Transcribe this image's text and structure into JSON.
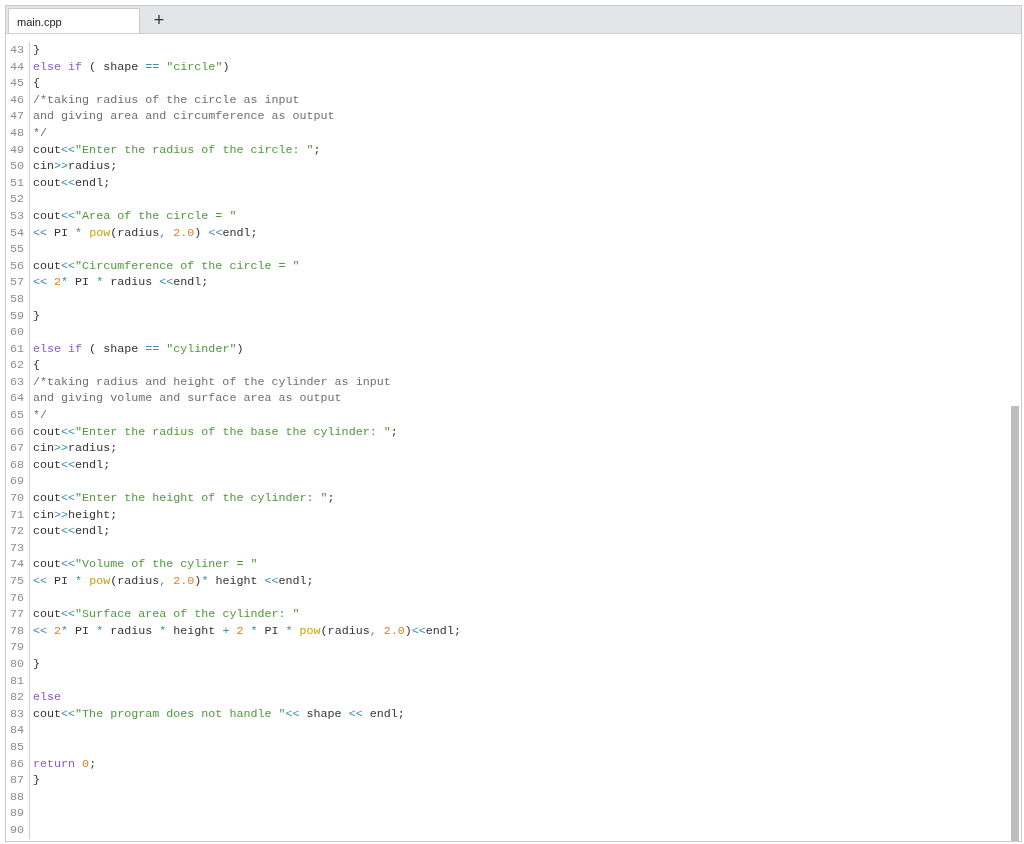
{
  "tabs": [
    {
      "label": "main.cpp",
      "selected": true
    }
  ],
  "new_tab": {
    "label": "+"
  },
  "lines": [
    {
      "number": "43",
      "tokens": [
        {
          "kind": "plain",
          "text": "}"
        }
      ]
    },
    {
      "number": "44",
      "tokens": [
        {
          "kind": "keyword",
          "text": "else if"
        },
        {
          "kind": "plain",
          "text": " ( shape "
        },
        {
          "kind": "operator",
          "text": "== "
        },
        {
          "kind": "string",
          "text": "\"circle\""
        },
        {
          "kind": "plain",
          "text": ")"
        }
      ]
    },
    {
      "number": "45",
      "tokens": [
        {
          "kind": "plain",
          "text": "{"
        }
      ]
    },
    {
      "number": "46",
      "tokens": [
        {
          "kind": "comment",
          "text": "/*taking radius of the circle as input"
        }
      ]
    },
    {
      "number": "47",
      "tokens": [
        {
          "kind": "comment",
          "text": "and giving area and circumference as output"
        }
      ]
    },
    {
      "number": "48",
      "tokens": [
        {
          "kind": "comment",
          "text": "*/"
        }
      ]
    },
    {
      "number": "49",
      "tokens": [
        {
          "kind": "plain",
          "text": "cout"
        },
        {
          "kind": "operator",
          "text": "<<"
        },
        {
          "kind": "string",
          "text": "\"Enter the radius of the circle: \""
        },
        {
          "kind": "plain",
          "text": ";"
        }
      ]
    },
    {
      "number": "50",
      "tokens": [
        {
          "kind": "plain",
          "text": "cin"
        },
        {
          "kind": "operator",
          "text": ">>"
        },
        {
          "kind": "plain",
          "text": "radius;"
        }
      ]
    },
    {
      "number": "51",
      "tokens": [
        {
          "kind": "plain",
          "text": "cout"
        },
        {
          "kind": "operator",
          "text": "<<"
        },
        {
          "kind": "plain",
          "text": "endl;"
        }
      ]
    },
    {
      "number": "52"
    },
    {
      "number": "53",
      "tokens": [
        {
          "kind": "plain",
          "text": "cout"
        },
        {
          "kind": "operator",
          "text": "<<"
        },
        {
          "kind": "string",
          "text": "\"Area of the circle = \""
        }
      ]
    },
    {
      "number": "54",
      "tokens": [
        {
          "kind": "operator",
          "text": "<<"
        },
        {
          "kind": "plain",
          "text": " PI "
        },
        {
          "kind": "operator",
          "text": "* "
        },
        {
          "kind": "function",
          "text": "pow"
        },
        {
          "kind": "plain",
          "text": "(radius"
        },
        {
          "kind": "operator",
          "text": ", "
        },
        {
          "kind": "number",
          "text": "2.0"
        },
        {
          "kind": "plain",
          "text": ") "
        },
        {
          "kind": "operator",
          "text": "<<"
        },
        {
          "kind": "plain",
          "text": "endl;"
        }
      ]
    },
    {
      "number": "55"
    },
    {
      "number": "56",
      "tokens": [
        {
          "kind": "plain",
          "text": "cout"
        },
        {
          "kind": "operator",
          "text": "<<"
        },
        {
          "kind": "string",
          "text": "\"Circumference of the circle = \""
        }
      ]
    },
    {
      "number": "57",
      "tokens": [
        {
          "kind": "operator",
          "text": "<< "
        },
        {
          "kind": "number",
          "text": "2"
        },
        {
          "kind": "operator",
          "text": "*"
        },
        {
          "kind": "plain",
          "text": " PI "
        },
        {
          "kind": "operator",
          "text": "*"
        },
        {
          "kind": "plain",
          "text": " radius "
        },
        {
          "kind": "operator",
          "text": "<<"
        },
        {
          "kind": "plain",
          "text": "endl;"
        }
      ]
    },
    {
      "number": "58"
    },
    {
      "number": "59",
      "tokens": [
        {
          "kind": "plain",
          "text": "}"
        }
      ]
    },
    {
      "number": "60"
    },
    {
      "number": "61",
      "tokens": [
        {
          "kind": "keyword",
          "text": "else if"
        },
        {
          "kind": "plain",
          "text": " ( shape "
        },
        {
          "kind": "operator",
          "text": "== "
        },
        {
          "kind": "string",
          "text": "\"cylinder\""
        },
        {
          "kind": "plain",
          "text": ")"
        }
      ]
    },
    {
      "number": "62",
      "tokens": [
        {
          "kind": "plain",
          "text": "{"
        }
      ]
    },
    {
      "number": "63",
      "tokens": [
        {
          "kind": "comment",
          "text": "/*taking radius and height of the cylinder as input"
        }
      ]
    },
    {
      "number": "64",
      "tokens": [
        {
          "kind": "comment",
          "text": "and giving volume and surface area as output"
        }
      ]
    },
    {
      "number": "65",
      "tokens": [
        {
          "kind": "comment",
          "text": "*/"
        }
      ]
    },
    {
      "number": "66",
      "tokens": [
        {
          "kind": "plain",
          "text": "cout"
        },
        {
          "kind": "operator",
          "text": "<<"
        },
        {
          "kind": "string",
          "text": "\"Enter the radius of the base the cylinder: \""
        },
        {
          "kind": "plain",
          "text": ";"
        }
      ]
    },
    {
      "number": "67",
      "tokens": [
        {
          "kind": "plain",
          "text": "cin"
        },
        {
          "kind": "operator",
          "text": ">>"
        },
        {
          "kind": "plain",
          "text": "radius;"
        }
      ]
    },
    {
      "number": "68",
      "tokens": [
        {
          "kind": "plain",
          "text": "cout"
        },
        {
          "kind": "operator",
          "text": "<<"
        },
        {
          "kind": "plain",
          "text": "endl;"
        }
      ]
    },
    {
      "number": "69"
    },
    {
      "number": "70",
      "tokens": [
        {
          "kind": "plain",
          "text": "cout"
        },
        {
          "kind": "operator",
          "text": "<<"
        },
        {
          "kind": "string",
          "text": "\"Enter the height of the cylinder: \""
        },
        {
          "kind": "plain",
          "text": ";"
        }
      ]
    },
    {
      "number": "71",
      "tokens": [
        {
          "kind": "plain",
          "text": "cin"
        },
        {
          "kind": "operator",
          "text": ">>"
        },
        {
          "kind": "plain",
          "text": "height;"
        }
      ]
    },
    {
      "number": "72",
      "tokens": [
        {
          "kind": "plain",
          "text": "cout"
        },
        {
          "kind": "operator",
          "text": "<<"
        },
        {
          "kind": "plain",
          "text": "endl;"
        }
      ]
    },
    {
      "number": "73"
    },
    {
      "number": "74",
      "tokens": [
        {
          "kind": "plain",
          "text": "cout"
        },
        {
          "kind": "operator",
          "text": "<<"
        },
        {
          "kind": "string",
          "text": "\"Volume of the cyliner = \""
        }
      ]
    },
    {
      "number": "75",
      "tokens": [
        {
          "kind": "operator",
          "text": "<<"
        },
        {
          "kind": "plain",
          "text": " PI "
        },
        {
          "kind": "operator",
          "text": "* "
        },
        {
          "kind": "function",
          "text": "pow"
        },
        {
          "kind": "plain",
          "text": "(radius"
        },
        {
          "kind": "operator",
          "text": ", "
        },
        {
          "kind": "number",
          "text": "2.0"
        },
        {
          "kind": "plain",
          "text": ")"
        },
        {
          "kind": "operator",
          "text": "*"
        },
        {
          "kind": "plain",
          "text": " height "
        },
        {
          "kind": "operator",
          "text": "<<"
        },
        {
          "kind": "plain",
          "text": "endl;"
        }
      ]
    },
    {
      "number": "76"
    },
    {
      "number": "77",
      "tokens": [
        {
          "kind": "plain",
          "text": "cout"
        },
        {
          "kind": "operator",
          "text": "<<"
        },
        {
          "kind": "string",
          "text": "\"Surface area of the cylinder: \""
        }
      ]
    },
    {
      "number": "78",
      "tokens": [
        {
          "kind": "operator",
          "text": "<< "
        },
        {
          "kind": "number",
          "text": "2"
        },
        {
          "kind": "operator",
          "text": "*"
        },
        {
          "kind": "plain",
          "text": " PI "
        },
        {
          "kind": "operator",
          "text": "*"
        },
        {
          "kind": "plain",
          "text": " radius "
        },
        {
          "kind": "operator",
          "text": "*"
        },
        {
          "kind": "plain",
          "text": " height "
        },
        {
          "kind": "operator",
          "text": "+ "
        },
        {
          "kind": "number",
          "text": "2 "
        },
        {
          "kind": "operator",
          "text": "*"
        },
        {
          "kind": "plain",
          "text": " PI "
        },
        {
          "kind": "operator",
          "text": "* "
        },
        {
          "kind": "function",
          "text": "pow"
        },
        {
          "kind": "plain",
          "text": "(radius"
        },
        {
          "kind": "operator",
          "text": ", "
        },
        {
          "kind": "number",
          "text": "2.0"
        },
        {
          "kind": "plain",
          "text": ")"
        },
        {
          "kind": "operator",
          "text": "<<"
        },
        {
          "kind": "plain",
          "text": "endl;"
        }
      ]
    },
    {
      "number": "79"
    },
    {
      "number": "80",
      "tokens": [
        {
          "kind": "plain",
          "text": "}"
        }
      ]
    },
    {
      "number": "81"
    },
    {
      "number": "82",
      "tokens": [
        {
          "kind": "keyword",
          "text": "else"
        }
      ]
    },
    {
      "number": "83",
      "tokens": [
        {
          "kind": "plain",
          "text": "cout"
        },
        {
          "kind": "operator",
          "text": "<<"
        },
        {
          "kind": "string",
          "text": "\"The program does not handle \""
        },
        {
          "kind": "operator",
          "text": "<<"
        },
        {
          "kind": "plain",
          "text": " shape "
        },
        {
          "kind": "operator",
          "text": "<<"
        },
        {
          "kind": "plain",
          "text": " endl;"
        }
      ]
    },
    {
      "number": "84"
    },
    {
      "number": "85"
    },
    {
      "number": "86",
      "tokens": [
        {
          "kind": "keyword",
          "text": "return "
        },
        {
          "kind": "number",
          "text": "0"
        },
        {
          "kind": "plain",
          "text": ";"
        }
      ]
    },
    {
      "number": "87",
      "tokens": [
        {
          "kind": "plain",
          "text": "}"
        }
      ]
    },
    {
      "number": "88"
    },
    {
      "number": "89"
    },
    {
      "number": "90"
    }
  ]
}
